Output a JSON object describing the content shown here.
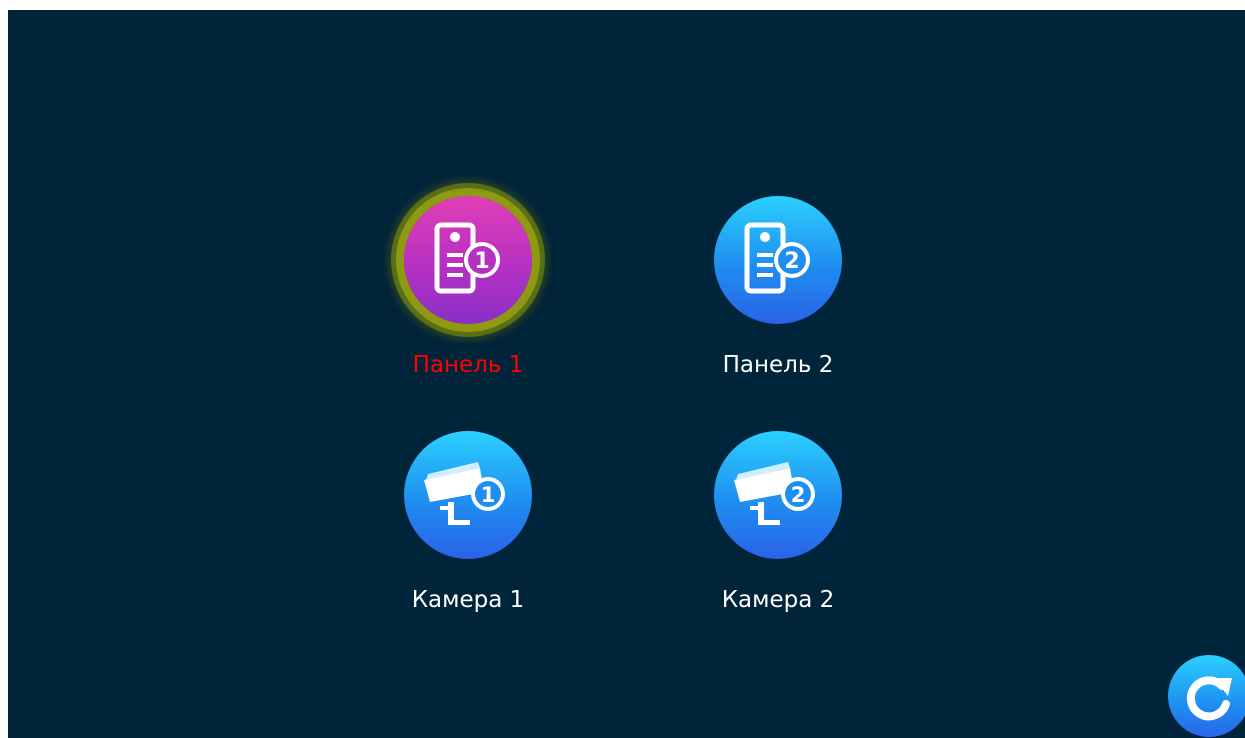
{
  "menu": {
    "items": [
      {
        "label": "Панель 1",
        "icon": "door-panel-1-icon",
        "badge": "1",
        "selected": true
      },
      {
        "label": "Панель 2",
        "icon": "door-panel-2-icon",
        "badge": "2",
        "selected": false
      },
      {
        "label": "Камера 1",
        "icon": "camera-1-icon",
        "badge": "1",
        "selected": false
      },
      {
        "label": "Камера 2",
        "icon": "camera-2-icon",
        "badge": "2",
        "selected": false
      }
    ]
  },
  "refresh_button": {
    "icon": "refresh-icon"
  },
  "colors": {
    "background": "#00243a",
    "selected_label": "#ff0000",
    "label": "#ffffff",
    "icon_blue": "#1f8ef0",
    "icon_selected": "#b630c2",
    "selection_ring": "#8f9a12"
  }
}
